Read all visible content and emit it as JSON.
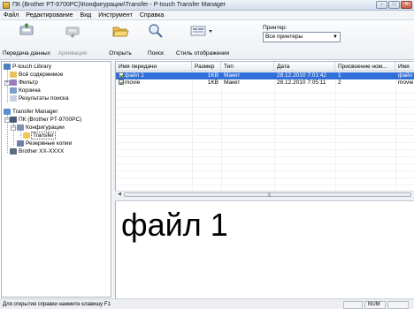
{
  "window": {
    "title": "ПК (Brother PT-9700PC)\\Конфигурации\\Transfer - P-touch Transfer Manager",
    "minimize": "–",
    "maximize": "□",
    "close": "✕"
  },
  "menu": [
    "Файл",
    "Редактирование",
    "Вид",
    "Инструмент",
    "Справка"
  ],
  "toolbar": {
    "transfer_label": "Передача данных",
    "archive_label": "Архивация",
    "open_label": "Открыть",
    "search_label": "Поиск",
    "view_style_label": "Стиль отображения",
    "printer_label": "Принтер:",
    "printer_value": "Все принтеры"
  },
  "tree": [
    {
      "label": "P-touch Library",
      "icon": "library-icon"
    },
    {
      "label": "Всё содержимое",
      "icon": "folder-icon"
    },
    {
      "label": "Фильтр",
      "icon": "filter-icon"
    },
    {
      "label": "Корзина",
      "icon": "recycle-bin-icon"
    },
    {
      "label": "Результаты поиска",
      "icon": "search-results-icon"
    },
    {
      "label": "Transfer Manager",
      "icon": "transfer-manager-icon"
    },
    {
      "label": "ПК (Brother PT-9700PC)",
      "icon": "computer-icon"
    },
    {
      "label": "Конфигурации",
      "icon": "configurations-icon"
    },
    {
      "label": "Transfer",
      "icon": "folder-icon"
    },
    {
      "label": "Резервные копии",
      "icon": "backup-icon"
    },
    {
      "label": "Brother XX-XXXX",
      "icon": "printer-icon"
    }
  ],
  "list": {
    "columns": [
      "Имя передачи",
      "Размер",
      "Тип",
      "Дата",
      "Присвоение ном...",
      "Имя"
    ],
    "rows": [
      {
        "name": "файл 1",
        "size": "1KB",
        "type": "Макет",
        "date": "28.12.2010 7:01:42",
        "number": "1",
        "filename": "файл",
        "checked": true,
        "selected": true
      },
      {
        "name": "movie",
        "size": "1KB",
        "type": "Макет",
        "date": "28.12.2010 7:05:11",
        "number": "2",
        "filename": "movie.",
        "checked": true,
        "selected": false
      }
    ]
  },
  "preview": {
    "text": "файл 1"
  },
  "status": {
    "text": "Для открытия справки нажмите клавишу F1",
    "num": "NUM"
  }
}
